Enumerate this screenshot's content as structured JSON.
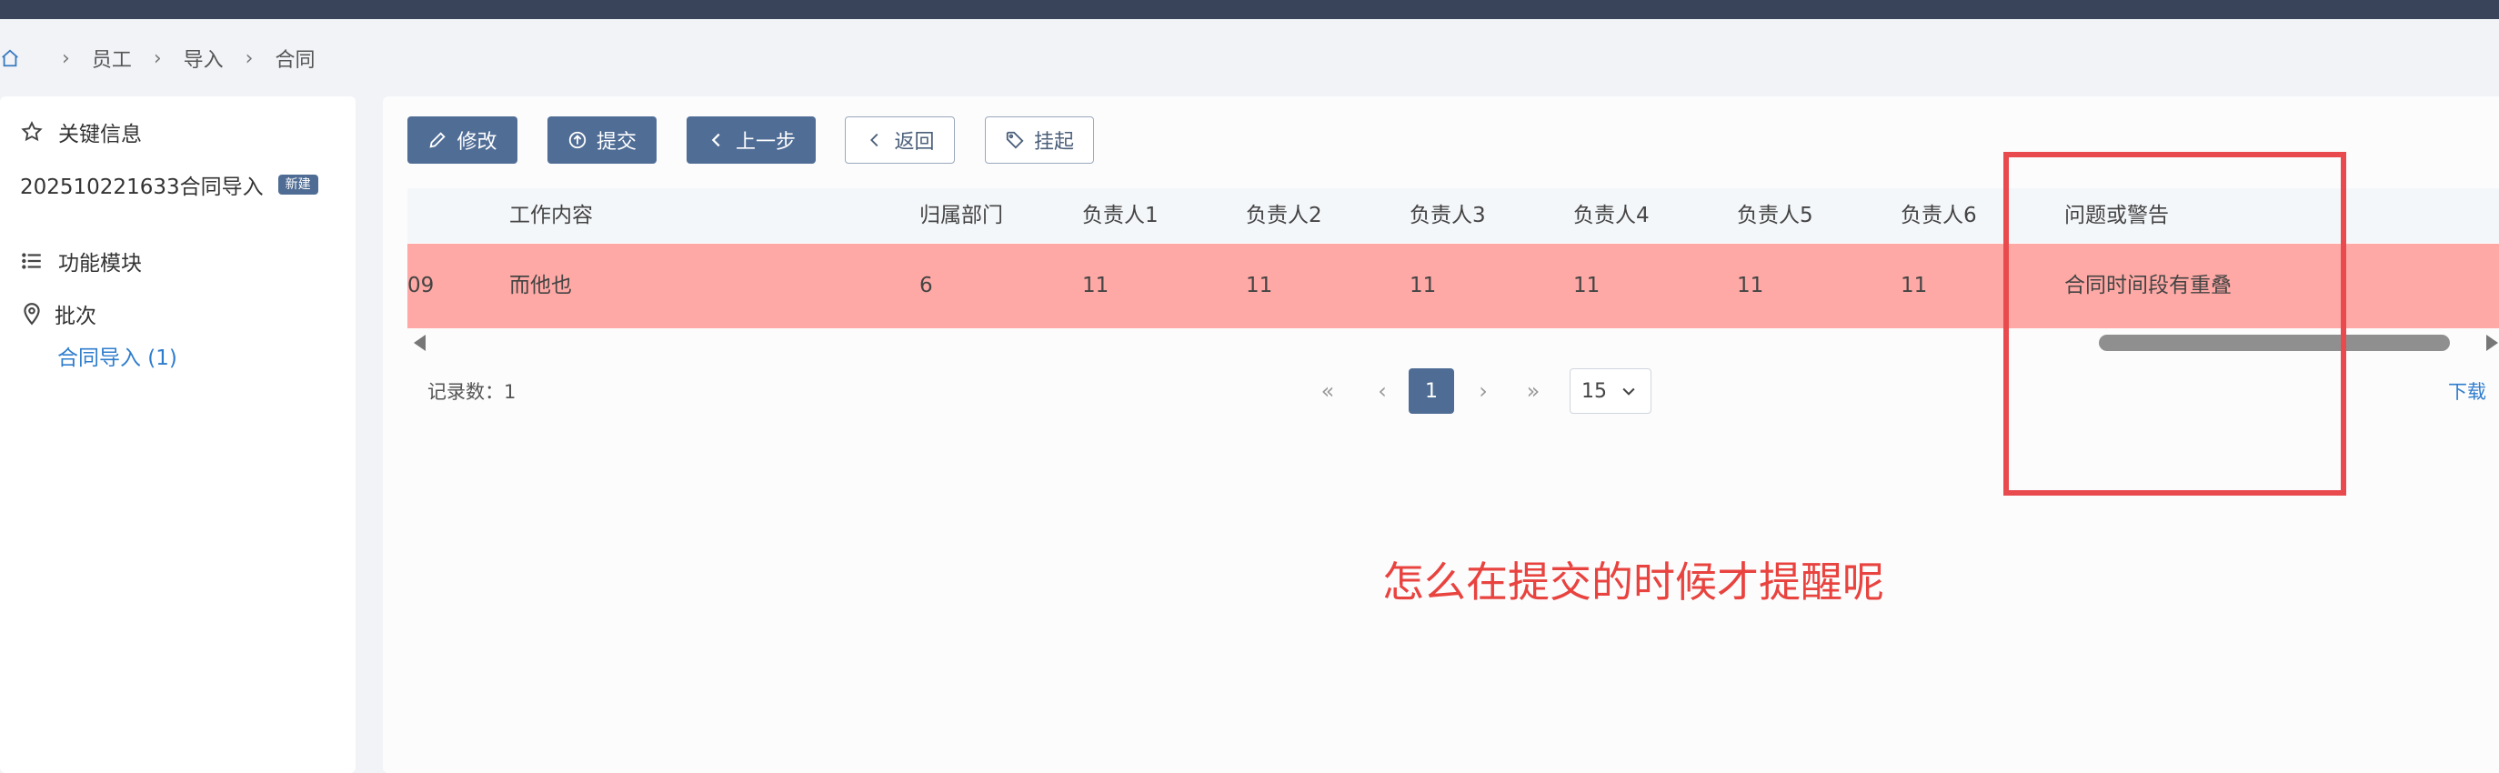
{
  "breadcrumb": {
    "items": [
      "员工",
      "导入",
      "合同"
    ]
  },
  "sidebar": {
    "key_info_label": "关键信息",
    "record_title": "202510221633合同导入",
    "record_badge": "新建",
    "modules_label": "功能模块",
    "batch_label": "批次",
    "batch_link": "合同导入 (1)"
  },
  "toolbar": {
    "edit_label": "修改",
    "submit_label": "提交",
    "prev_label": "上一步",
    "back_label": "返回",
    "suspend_label": "挂起"
  },
  "table": {
    "columns": [
      "工作内容",
      "归属部门",
      "负责人1",
      "负责人2",
      "负责人3",
      "负责人4",
      "负责人5",
      "负责人6",
      "问题或警告"
    ],
    "rows": [
      {
        "first_cell_partial": "09",
        "cells": [
          "而他也",
          "6",
          "11",
          "11",
          "11",
          "11",
          "11",
          "11",
          "合同时间段有重叠"
        ]
      }
    ]
  },
  "pagination": {
    "records_text": "记录数：1",
    "first_label": "«",
    "prev_label": "‹",
    "current_page": "1",
    "next_label": "›",
    "last_label": "»",
    "page_size": "15"
  },
  "download_label": "下载",
  "annotation": {
    "text": "怎么在提交的时候才提醒呢",
    "color": "#e8433f"
  },
  "colors": {
    "topbar": "#39435a",
    "primary_button": "#506d96",
    "warning_row": "#fea9a5",
    "link": "#2f7dcd"
  }
}
